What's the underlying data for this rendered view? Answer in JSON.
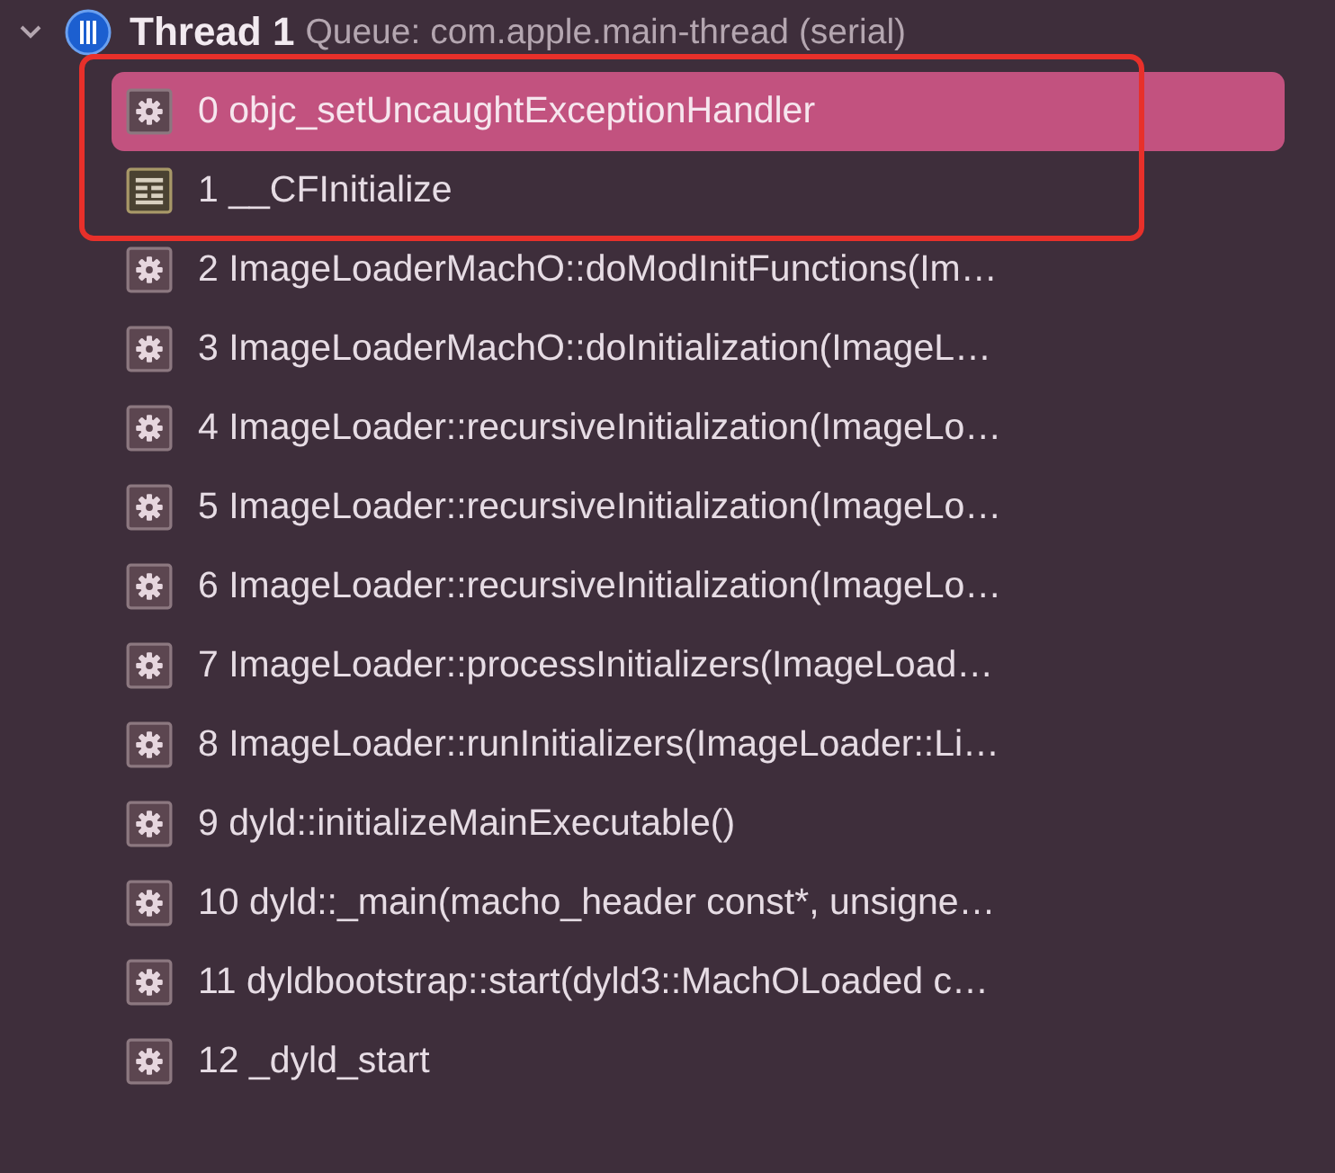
{
  "thread": {
    "expanded": true,
    "title": "Thread 1",
    "queue": "Queue: com.apple.main-thread (serial)"
  },
  "frames": [
    {
      "kind": "system",
      "label": "0 objc_setUncaughtExceptionHandler",
      "selected": true,
      "boxed": true
    },
    {
      "kind": "framework",
      "label": "1 __CFInitialize",
      "selected": false,
      "boxed": true
    },
    {
      "kind": "system",
      "label": "2 ImageLoaderMachO::doModInitFunctions(Im…",
      "selected": false,
      "boxed": false
    },
    {
      "kind": "system",
      "label": "3 ImageLoaderMachO::doInitialization(ImageL…",
      "selected": false,
      "boxed": false
    },
    {
      "kind": "system",
      "label": "4 ImageLoader::recursiveInitialization(ImageLo…",
      "selected": false,
      "boxed": false
    },
    {
      "kind": "system",
      "label": "5 ImageLoader::recursiveInitialization(ImageLo…",
      "selected": false,
      "boxed": false
    },
    {
      "kind": "system",
      "label": "6 ImageLoader::recursiveInitialization(ImageLo…",
      "selected": false,
      "boxed": false
    },
    {
      "kind": "system",
      "label": "7 ImageLoader::processInitializers(ImageLoad…",
      "selected": false,
      "boxed": false
    },
    {
      "kind": "system",
      "label": "8 ImageLoader::runInitializers(ImageLoader::Li…",
      "selected": false,
      "boxed": false
    },
    {
      "kind": "system",
      "label": "9 dyld::initializeMainExecutable()",
      "selected": false,
      "boxed": false
    },
    {
      "kind": "system",
      "label": "10 dyld::_main(macho_header const*, unsigne…",
      "selected": false,
      "boxed": false
    },
    {
      "kind": "system",
      "label": "11 dyldbootstrap::start(dyld3::MachOLoaded c…",
      "selected": false,
      "boxed": false
    },
    {
      "kind": "system",
      "label": "12 _dyld_start",
      "selected": false,
      "boxed": false
    }
  ]
}
